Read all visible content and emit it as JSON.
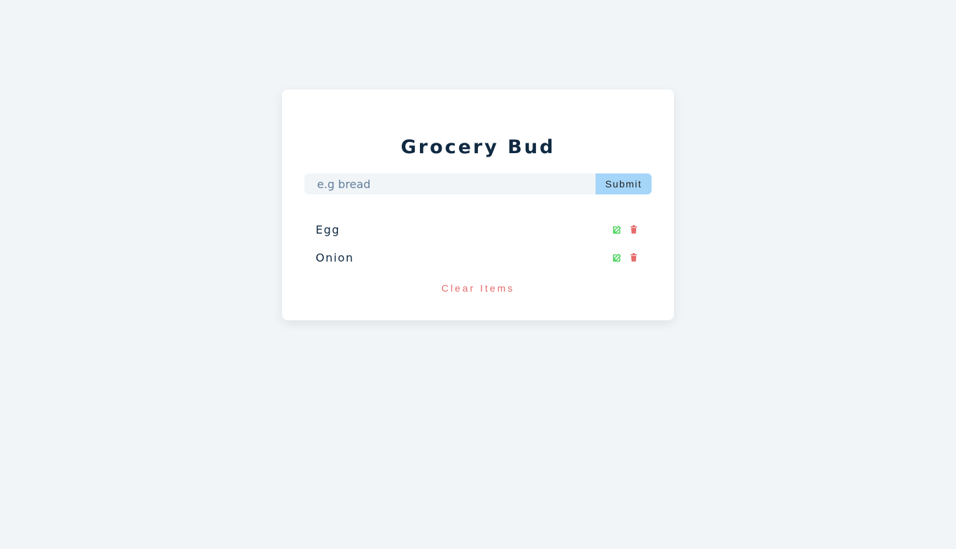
{
  "app": {
    "title": "Grocery Bud"
  },
  "form": {
    "placeholder": "e.g bread",
    "value": "",
    "submit_label": "Submit"
  },
  "items": [
    {
      "label": "Egg",
      "edit_icon": "edit-icon",
      "delete_icon": "trash-icon"
    },
    {
      "label": "Onion",
      "edit_icon": "edit-icon",
      "delete_icon": "trash-icon"
    }
  ],
  "clear_label": "Clear Items",
  "colors": {
    "background": "#f1f5f8",
    "title": "#102a42",
    "submit_bg": "#a5d5f8",
    "edit": "#4cd35c",
    "delete": "#e66b6b"
  }
}
